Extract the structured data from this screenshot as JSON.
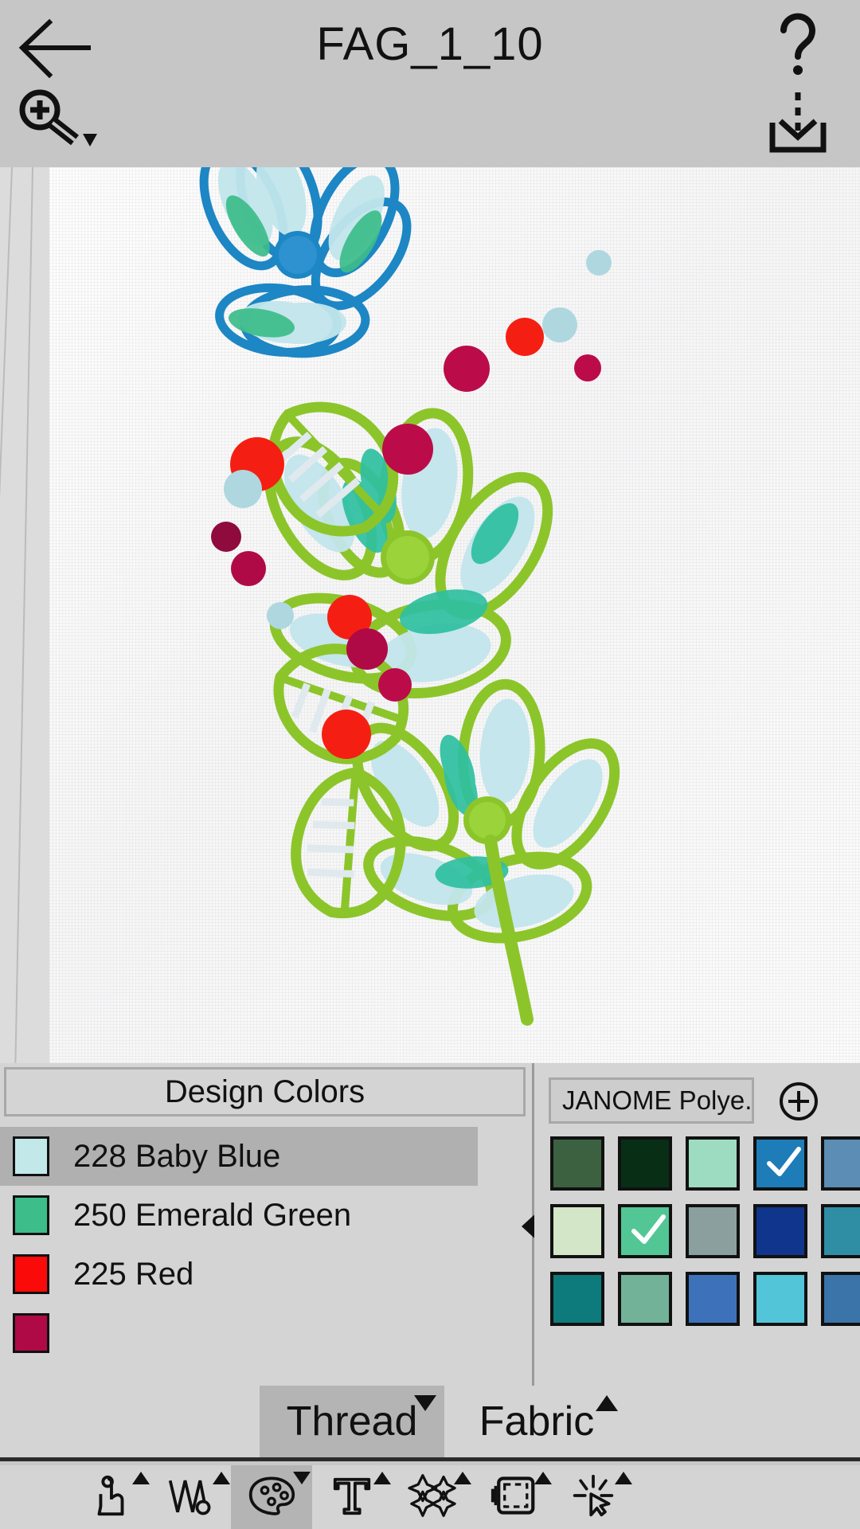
{
  "header": {
    "title": "FAG_1_10",
    "back_icon": "back-arrow-icon",
    "help_icon": "question-mark-icon",
    "save_icon": "save-download-icon",
    "zoom_icon": "zoom-in-magnifier-icon"
  },
  "canvas": {
    "ruler_icon": "ruler-measure-icon",
    "fabric_color": "#fbfbfb"
  },
  "design_colors": {
    "header_label": "Design Colors",
    "items": [
      {
        "code": "228",
        "name": "228 Baby Blue",
        "hex": "#c2e8ea",
        "selected": true
      },
      {
        "code": "250",
        "name": "250 Emerald Green",
        "hex": "#3cbd8a",
        "selected": false
      },
      {
        "code": "225",
        "name": "225 Red",
        "hex": "#fb0a0a",
        "selected": false
      },
      {
        "code": "",
        "name": "",
        "hex": "#b00a46",
        "selected": false
      }
    ]
  },
  "thread_palette": {
    "brand_label": "JANOME Polye...",
    "add_label": "add-thread-icon",
    "swatches": [
      {
        "hex": "#3c6140",
        "checked": false
      },
      {
        "hex": "#082e16",
        "checked": false
      },
      {
        "hex": "#9ddcc1",
        "checked": false
      },
      {
        "hex": "#1e7cb8",
        "checked": true
      },
      {
        "hex": "#5b8db5",
        "checked": false
      },
      {
        "hex": "#d3e6c8",
        "checked": false
      },
      {
        "hex": "#52c795",
        "checked": true
      },
      {
        "hex": "#8ba09e",
        "checked": false
      },
      {
        "hex": "#10358c",
        "checked": false
      },
      {
        "hex": "#2f8ea3",
        "checked": false
      },
      {
        "hex": "#0d7b7b",
        "checked": false
      },
      {
        "hex": "#72b298",
        "checked": false
      },
      {
        "hex": "#3d72bb",
        "checked": false
      },
      {
        "hex": "#52c6d8",
        "checked": false
      },
      {
        "hex": "#3a74a8",
        "checked": false
      }
    ]
  },
  "tabs": [
    {
      "label": "Thread",
      "active": true,
      "arrow": "down"
    },
    {
      "label": "Fabric",
      "active": false,
      "arrow": "up"
    }
  ],
  "toolbar": {
    "items": [
      {
        "icon": "pointing-hand-icon",
        "label": "Select",
        "active": false,
        "arrow": "up"
      },
      {
        "icon": "stitch-zigzag-icon",
        "label": "Stitch",
        "active": false,
        "arrow": "up"
      },
      {
        "icon": "palette-icon",
        "label": "Color",
        "active": true,
        "arrow": "down"
      },
      {
        "icon": "text-t-icon",
        "label": "Text",
        "active": false,
        "arrow": "up"
      },
      {
        "icon": "sparkles-icon",
        "label": "Effects",
        "active": false,
        "arrow": "up"
      },
      {
        "icon": "hoop-frame-icon",
        "label": "Hoop",
        "active": false,
        "arrow": "up"
      },
      {
        "icon": "click-cursor-icon",
        "label": "Edit",
        "active": false,
        "arrow": "up"
      }
    ]
  },
  "design_art": {
    "outline_blue": "#1d86c4",
    "outline_green": "#8cc52a",
    "fill_babyblue": "#c2e6ec",
    "fill_emerald": "#3cbd8a",
    "dot_red": "#f41f12",
    "dot_crimson": "#bb0c49",
    "dot_blue": "#aed7e0"
  }
}
